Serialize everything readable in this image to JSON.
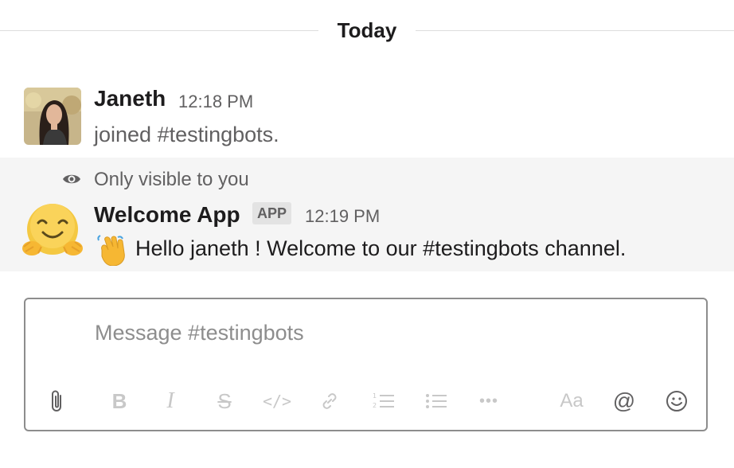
{
  "divider": {
    "label": "Today"
  },
  "messages": [
    {
      "author": "Janeth",
      "time": "12:18 PM",
      "text": "joined #testingbots."
    },
    {
      "notice": "Only visible to you",
      "author": "Welcome App",
      "badge": "APP",
      "time": "12:19 PM",
      "emoji": "waving-hand",
      "text": "Hello janeth ! Welcome to our #testingbots channel."
    }
  ],
  "composer": {
    "placeholder": "Message #testingbots",
    "toolbar": [
      "paperclip-icon",
      "bold-icon",
      "italic-icon",
      "strikethrough-icon",
      "code-icon",
      "link-icon",
      "ordered-list-icon",
      "bulleted-list-icon",
      "more-icon",
      "formatting-icon",
      "mention-icon",
      "emoji-icon"
    ],
    "formatting_label": "Aa",
    "mention_label": "@"
  },
  "colors": {
    "primary_text": "#1d1c1d",
    "secondary_text": "#616061",
    "highlight_bg": "#f5f5f5"
  }
}
